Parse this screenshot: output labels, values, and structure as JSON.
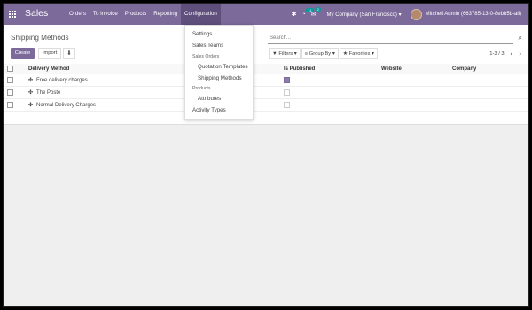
{
  "navbar": {
    "app_title": "Sales",
    "menu": [
      {
        "label": "Orders"
      },
      {
        "label": "To Invoice"
      },
      {
        "label": "Products"
      },
      {
        "label": "Reporting"
      },
      {
        "label": "Configuration"
      }
    ],
    "bug_icon": "bug-icon",
    "activity_badge": "11",
    "messages_badge": "2",
    "company": "My Company (San Francisco)",
    "user": "Mitchell Admin (663785-13-0-8ebb5b-all)"
  },
  "dropdown": {
    "settings": "Settings",
    "sales_teams": "Sales Teams",
    "sales_orders_header": "Sales Orders",
    "quotation_templates": "Quotation Templates",
    "shipping_methods": "Shipping Methods",
    "products_header": "Products",
    "attributes": "Attributes",
    "activity_types": "Activity Types"
  },
  "control": {
    "title": "Shipping Methods",
    "create": "Create",
    "import": "Import",
    "search_placeholder": "Search...",
    "filters": "Filters",
    "group_by": "Group By",
    "favorites": "Favorites",
    "pager": "1-3 / 3"
  },
  "table": {
    "columns": {
      "delivery_method": "Delivery Method",
      "is_published": "Is Published",
      "website": "Website",
      "company": "Company"
    },
    "rows": [
      {
        "name": "Free delivery charges",
        "published": true
      },
      {
        "name": "The Poste",
        "published": false
      },
      {
        "name": "Normal Delivery Charges",
        "published": false
      }
    ]
  },
  "colors": {
    "navbar": "#7c6a9b",
    "active_menu": "#5f4f7d",
    "badge": "#00a09d"
  }
}
